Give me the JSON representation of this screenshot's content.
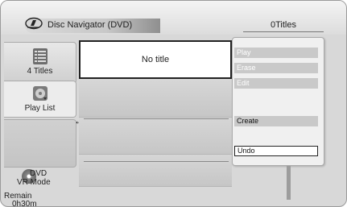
{
  "header": {
    "title": "Disc Navigator (DVD)",
    "titles_count": "0Titles"
  },
  "sidebar": {
    "items": [
      {
        "label": "4 Titles",
        "icon": "list-icon"
      },
      {
        "label": "Play List",
        "icon": "playlist-icon"
      }
    ],
    "disc_type": "DVD",
    "mode": "VR Mode",
    "remain_label": "Remain",
    "remain_time": "0h30m"
  },
  "main": {
    "selected_title": "No title"
  },
  "popup_menu": {
    "items": [
      {
        "label": "Play",
        "enabled": false
      },
      {
        "label": "Erase",
        "enabled": false
      },
      {
        "label": "Edit",
        "enabled": false
      },
      {
        "label": "Create",
        "enabled": true
      },
      {
        "label": "Undo",
        "enabled": true,
        "selected": true
      }
    ]
  }
}
